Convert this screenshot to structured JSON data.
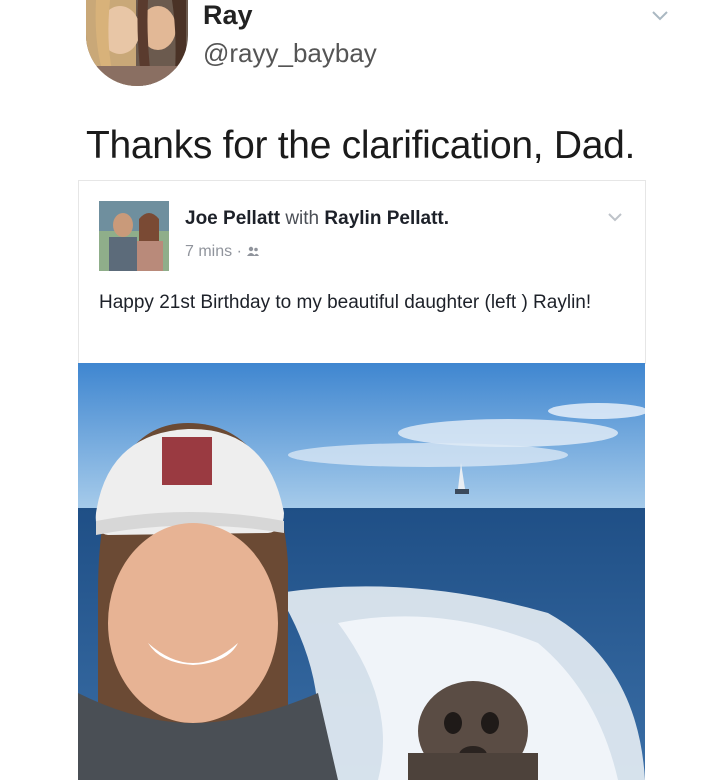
{
  "tweet": {
    "display_name": "Ray",
    "handle": "@rayy_baybay",
    "text": "Thanks for the clarification, Dad."
  },
  "embedded_post": {
    "author": "Joe Pellatt",
    "with_word": "with",
    "tagged": "Raylin Pellatt.",
    "time": "7 mins",
    "separator": "·",
    "audience_icon": "friends-icon",
    "text": "Happy 21st Birthday to my beautiful daughter (left ) Raylin!"
  },
  "icons": {
    "tweet_menu": "chevron-down-icon",
    "post_menu": "chevron-down-icon"
  },
  "colors": {
    "sky": "#5f9fd8",
    "ocean": "#2d5a8e",
    "text_primary": "#1b1b1b",
    "meta_gray": "#90949c"
  }
}
